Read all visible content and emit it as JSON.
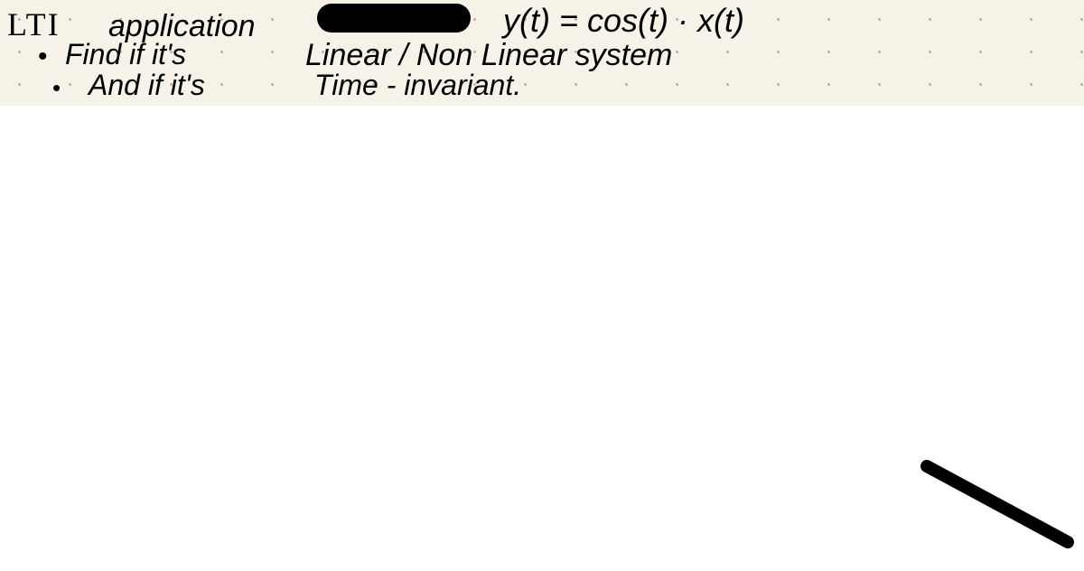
{
  "title": {
    "abbrev": "LTI",
    "word": "application"
  },
  "equation": "y(t) = cos(t) · x(t)",
  "bullets": {
    "b1": "•",
    "b2": "•"
  },
  "lines": {
    "find": "Find  if  it's",
    "linear": "Linear / Non  Linear  system",
    "and": "And  if  it's",
    "time": "Time -  invariant."
  }
}
